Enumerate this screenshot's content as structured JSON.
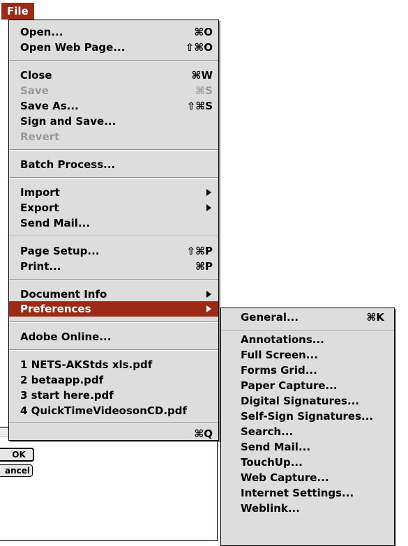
{
  "menubar": {
    "title": "File"
  },
  "file_menu": {
    "items": [
      {
        "label": "Open...",
        "shortcut": "⌘O"
      },
      {
        "label": "Open Web Page...",
        "shortcut": "⇧⌘O"
      },
      {
        "label": "Close",
        "shortcut": "⌘W"
      },
      {
        "label": "Save",
        "shortcut": "⌘S"
      },
      {
        "label": "Save As...",
        "shortcut": "⇧⌘S"
      },
      {
        "label": "Sign and Save...",
        "shortcut": ""
      },
      {
        "label": "Revert",
        "shortcut": ""
      },
      {
        "label": "Batch Process...",
        "shortcut": ""
      },
      {
        "label": "Import",
        "shortcut": ""
      },
      {
        "label": "Export",
        "shortcut": ""
      },
      {
        "label": "Send Mail...",
        "shortcut": ""
      },
      {
        "label": "Page Setup...",
        "shortcut": "⇧⌘P"
      },
      {
        "label": "Print...",
        "shortcut": "⌘P"
      },
      {
        "label": "Document Info",
        "shortcut": ""
      },
      {
        "label": "Preferences",
        "shortcut": ""
      },
      {
        "label": "Adobe Online...",
        "shortcut": ""
      },
      {
        "label": "1 NETS-AKStds xls.pdf",
        "shortcut": ""
      },
      {
        "label": "2 betaapp.pdf",
        "shortcut": ""
      },
      {
        "label": "3 start here.pdf",
        "shortcut": ""
      },
      {
        "label": "4 QuickTimeVideosonCD.pdf",
        "shortcut": ""
      },
      {
        "label": "",
        "shortcut": "⌘Q"
      }
    ]
  },
  "preferences_submenu": {
    "items": [
      {
        "label": "General...",
        "shortcut": "⌘K"
      },
      {
        "label": "Annotations..."
      },
      {
        "label": "Full Screen..."
      },
      {
        "label": "Forms Grid..."
      },
      {
        "label": "Paper Capture..."
      },
      {
        "label": "Digital Signatures..."
      },
      {
        "label": "Self-Sign Signatures..."
      },
      {
        "label": "Search..."
      },
      {
        "label": "Send Mail..."
      },
      {
        "label": "TouchUp..."
      },
      {
        "label": "Web Capture..."
      },
      {
        "label": "Internet Settings..."
      },
      {
        "label": "Weblink..."
      }
    ]
  },
  "dialog": {
    "ok_label": "OK",
    "cancel_label": "ancel"
  }
}
